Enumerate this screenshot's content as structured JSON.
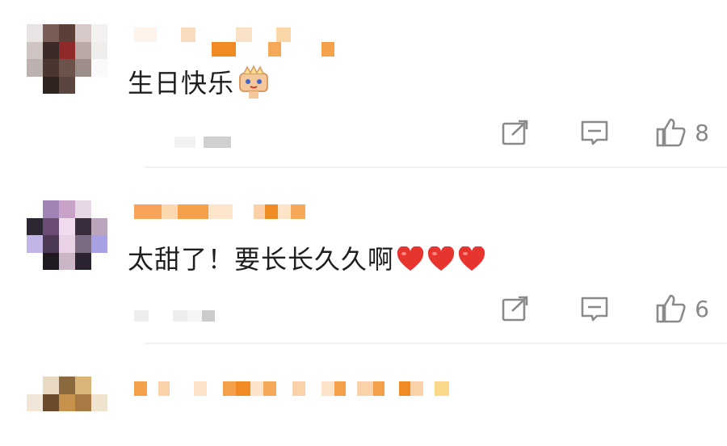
{
  "comments": [
    {
      "text": "生日快乐",
      "emoji": "cake-emoji",
      "likes": "8"
    },
    {
      "text": "太甜了！要长长久久啊",
      "emoji": "heart-emoji",
      "likes": "6"
    }
  ],
  "colors": {
    "accent_orange": "#f08a24",
    "light_orange": "#fbd3a5",
    "icon_gray": "#8a8a8a",
    "heart_red": "#e8342f"
  },
  "icons": [
    "share-icon",
    "comment-icon",
    "like-icon"
  ]
}
